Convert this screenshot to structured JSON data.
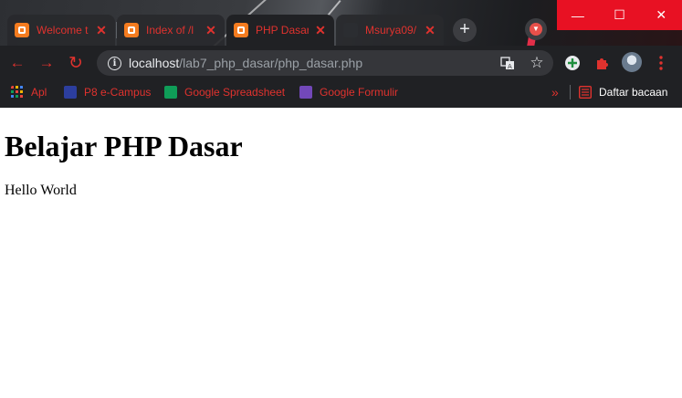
{
  "browser": {
    "tabs": [
      {
        "title": "Welcome t",
        "active": false
      },
      {
        "title": "Index of /l",
        "active": false
      },
      {
        "title": "PHP Dasar",
        "active": true
      },
      {
        "title": "Msurya09/",
        "active": false
      }
    ],
    "new_tab": "+",
    "window_controls": {
      "minimize": "—",
      "maximize": "☐",
      "close": "✕"
    },
    "address": {
      "host": "localhost",
      "path": "/lab7_php_dasar/php_dasar.php"
    },
    "bookmarks": [
      {
        "label": "Apl",
        "icon": "apps-grid-icon",
        "color": "#e8453c"
      },
      {
        "label": "P8 e-Campus",
        "icon": "campus-icon",
        "color": "#2c3e9e"
      },
      {
        "label": "Google Spreadsheet",
        "icon": "sheets-icon",
        "color": "#0f9d58"
      },
      {
        "label": "Google Formulir",
        "icon": "forms-icon",
        "color": "#7248b9"
      }
    ],
    "bookmarks_overflow": "»",
    "reading_list": "Daftar bacaan"
  },
  "page": {
    "heading": "Belajar PHP Dasar",
    "body_text": "Hello World"
  },
  "colors": {
    "accent_red": "#e0322e",
    "toolbar_bg": "#202124",
    "xampp_orange": "#f57c1f"
  }
}
